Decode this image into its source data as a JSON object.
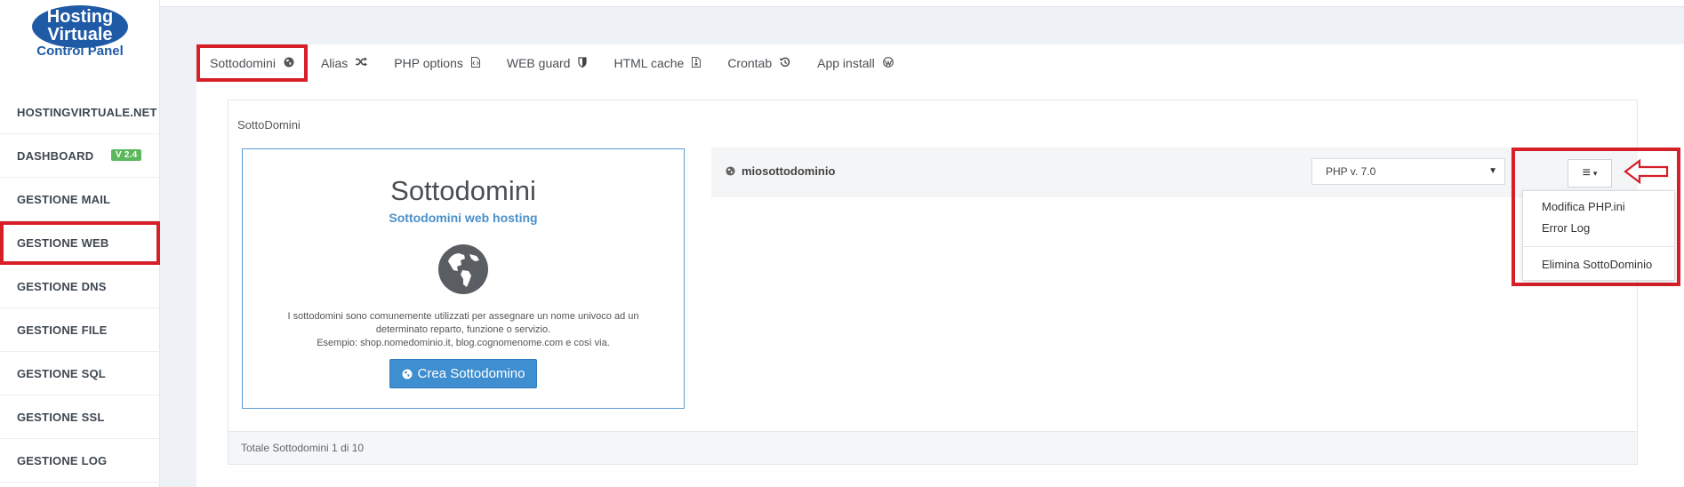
{
  "logo": {
    "line1": "Hosting",
    "line2": "Virtuale",
    "line3": "Control Panel"
  },
  "sidebar": {
    "items": [
      {
        "label": "HOSTINGVIRTUALE.NET"
      },
      {
        "label": "DASHBOARD",
        "badge": "V 2.4"
      },
      {
        "label": "GESTIONE MAIL"
      },
      {
        "label": "GESTIONE WEB",
        "active": true
      },
      {
        "label": "GESTIONE DNS"
      },
      {
        "label": "GESTIONE FILE"
      },
      {
        "label": "GESTIONE SQL"
      },
      {
        "label": "GESTIONE SSL"
      },
      {
        "label": "GESTIONE LOG"
      }
    ]
  },
  "tabs": [
    {
      "label": "Sottodomini",
      "icon": "globe-icon",
      "active": true
    },
    {
      "label": "Alias",
      "icon": "shuffle-icon"
    },
    {
      "label": "PHP options",
      "icon": "file-code-icon"
    },
    {
      "label": "WEB guard",
      "icon": "shield-icon"
    },
    {
      "label": "HTML cache",
      "icon": "file-zip-icon"
    },
    {
      "label": "Crontab",
      "icon": "history-icon"
    },
    {
      "label": "App install",
      "icon": "wordpress-icon"
    }
  ],
  "panel": {
    "title": "SottoDomini",
    "footer": "Totale Sottodomini 1 di 10"
  },
  "info": {
    "heading": "Sottodomini",
    "subheading": "Sottodomini web hosting",
    "desc_line1": "I sottodomini sono comunemente utilizzati per assegnare un nome univoco ad un determinato reparto, funzione o servizio.",
    "desc_line2": "Esempio: shop.nomedominio.it, blog.cognomenome.com e così via.",
    "create_button": "Crea Sottodomino"
  },
  "subdomain_row": {
    "name": "miosottodominio",
    "php_version": "PHP v. 7.0"
  },
  "actions_menu": {
    "items": [
      "Modifica PHP.ini",
      "Error Log",
      "Elimina SottoDominio"
    ]
  },
  "colors": {
    "highlight": "#d61f27",
    "primary": "#3e8ed0",
    "badge": "#5cb85c",
    "logo_blue": "#1f5aa6"
  }
}
